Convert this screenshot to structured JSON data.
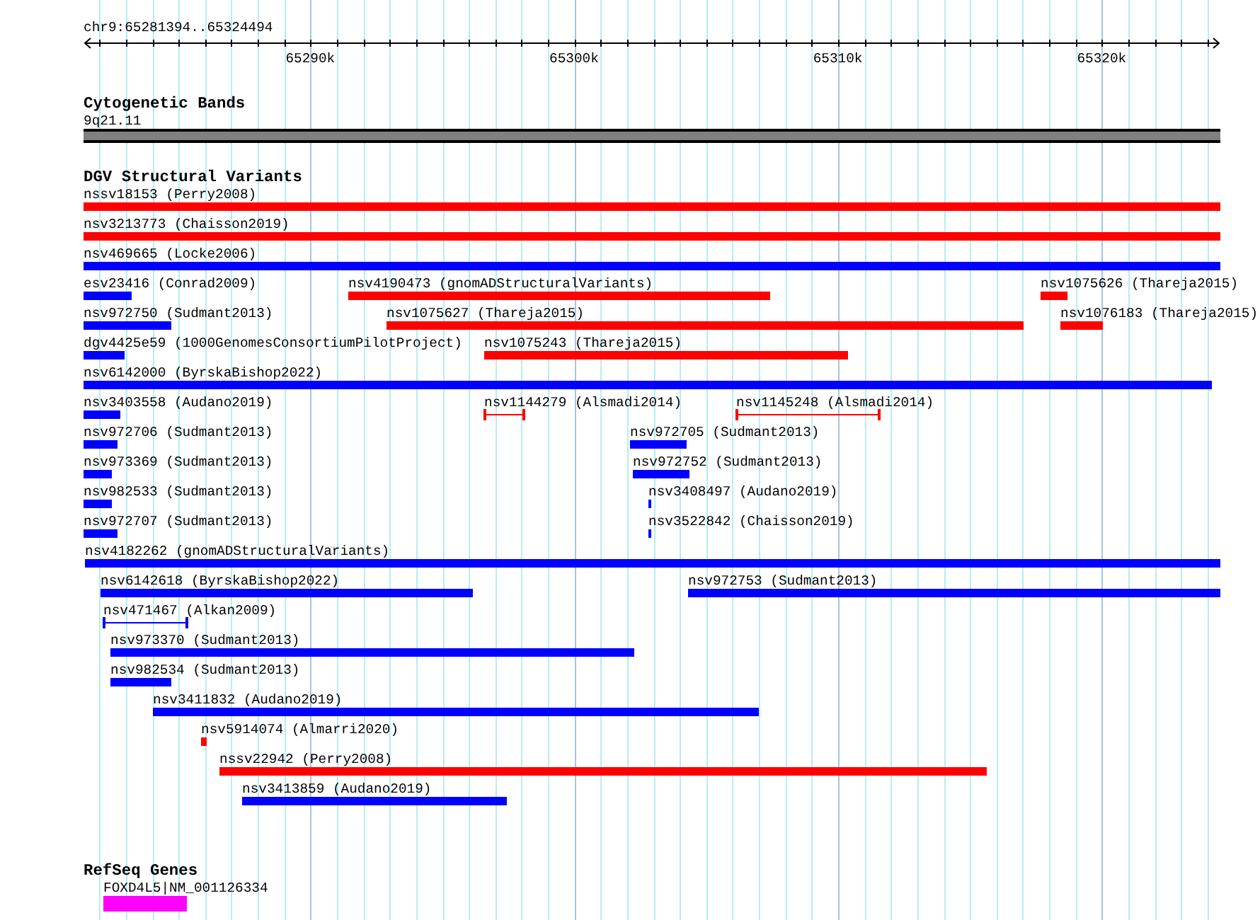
{
  "location": {
    "label": "chr9:65281394..65324494"
  },
  "ruler": {
    "ticks": [
      {
        "label": "65290k"
      },
      {
        "label": "65300k"
      },
      {
        "label": "65310k"
      },
      {
        "label": "65320k"
      }
    ]
  },
  "tracks": [
    {
      "kind": "cytoband",
      "title": "Cytogenetic Bands",
      "features": [
        {
          "label": "9q21.11"
        }
      ]
    },
    {
      "kind": "variants",
      "title": "DGV Structural Variants",
      "lanes": [
        {
          "features": [
            {
              "label": "nssv18153 (Perry2008)",
              "kind": "bar",
              "color": "#ff0000"
            }
          ]
        },
        {
          "features": [
            {
              "label": "nsv3213773 (Chaisson2019)",
              "kind": "bar",
              "color": "#ff0000"
            }
          ]
        },
        {
          "features": [
            {
              "label": "nsv469665 (Locke2006)",
              "kind": "bar",
              "color": "#0000ff"
            }
          ]
        },
        {
          "features": [
            {
              "label": "esv23416 (Conrad2009)",
              "kind": "bar",
              "color": "#0000ff"
            },
            {
              "label": "nsv4190473 (gnomADStructuralVariants)",
              "kind": "bar",
              "color": "#ff0000"
            },
            {
              "label": "nsv1075626 (Thareja2015)",
              "kind": "bar",
              "color": "#ff0000"
            }
          ]
        },
        {
          "features": [
            {
              "label": "nsv972750 (Sudmant2013)",
              "kind": "bar",
              "color": "#0000ff"
            },
            {
              "label": "nsv1075627 (Thareja2015)",
              "kind": "bar",
              "color": "#ff0000"
            },
            {
              "label": "nsv1076183 (Thareja2015)",
              "kind": "bar",
              "color": "#ff0000"
            }
          ]
        },
        {
          "features": [
            {
              "label": "dgv4425e59 (1000GenomesConsortiumPilotProject)",
              "kind": "bar",
              "color": "#0000ff"
            },
            {
              "label": "nsv1075243 (Thareja2015)",
              "kind": "bar",
              "color": "#ff0000"
            }
          ]
        },
        {
          "features": [
            {
              "label": "nsv6142000 (ByrskaBishop2022)",
              "kind": "bar",
              "color": "#0000ff"
            }
          ]
        },
        {
          "features": [
            {
              "label": "nsv3403558 (Audano2019)",
              "kind": "bar",
              "color": "#0000ff"
            },
            {
              "label": "nsv1144279 (Alsmadi2014)",
              "kind": "span",
              "color": "#ff0000"
            },
            {
              "label": "nsv1145248 (Alsmadi2014)",
              "kind": "span",
              "color": "#ff0000"
            }
          ]
        },
        {
          "features": [
            {
              "label": "nsv972706 (Sudmant2013)",
              "kind": "bar",
              "color": "#0000ff"
            },
            {
              "label": "nsv972705 (Sudmant2013)",
              "kind": "bar",
              "color": "#0000ff"
            }
          ]
        },
        {
          "features": [
            {
              "label": "nsv973369 (Sudmant2013)",
              "kind": "bar",
              "color": "#0000ff"
            },
            {
              "label": "nsv972752 (Sudmant2013)",
              "kind": "bar",
              "color": "#0000ff"
            }
          ]
        },
        {
          "features": [
            {
              "label": "nsv982533 (Sudmant2013)",
              "kind": "bar",
              "color": "#0000ff"
            },
            {
              "label": "nsv3408497 (Audano2019)",
              "kind": "bar",
              "color": "#0000ff"
            }
          ]
        },
        {
          "features": [
            {
              "label": "nsv972707 (Sudmant2013)",
              "kind": "bar",
              "color": "#0000ff"
            },
            {
              "label": "nsv3522842 (Chaisson2019)",
              "kind": "bar",
              "color": "#0000ff"
            }
          ]
        },
        {
          "features": [
            {
              "label": "nsv4182262 (gnomADStructuralVariants)",
              "kind": "bar",
              "color": "#0000ff"
            }
          ]
        },
        {
          "features": [
            {
              "label": "nsv6142618 (ByrskaBishop2022)",
              "kind": "bar",
              "color": "#0000ff"
            },
            {
              "label": "nsv972753 (Sudmant2013)",
              "kind": "bar",
              "color": "#0000ff"
            }
          ]
        },
        {
          "features": [
            {
              "label": "nsv471467 (Alkan2009)",
              "kind": "span",
              "color": "#0000ff"
            }
          ]
        },
        {
          "features": [
            {
              "label": "nsv973370 (Sudmant2013)",
              "kind": "bar",
              "color": "#0000ff"
            }
          ]
        },
        {
          "features": [
            {
              "label": "nsv982534 (Sudmant2013)",
              "kind": "bar",
              "color": "#0000ff"
            }
          ]
        },
        {
          "features": [
            {
              "label": "nsv3411832 (Audano2019)",
              "kind": "bar",
              "color": "#0000ff"
            }
          ]
        },
        {
          "features": [
            {
              "label": "nsv5914074 (Almarri2020)",
              "kind": "bar",
              "color": "#ff0000"
            }
          ]
        },
        {
          "features": [
            {
              "label": "nssv22942 (Perry2008)",
              "kind": "bar",
              "color": "#ff0000"
            }
          ]
        },
        {
          "features": [
            {
              "label": "nsv3413859 (Audano2019)",
              "kind": "bar",
              "color": "#0000ff"
            }
          ]
        }
      ]
    },
    {
      "kind": "genes",
      "title": "RefSeq Genes",
      "features": [
        {
          "label": "FOXD4L5|NM_001126334"
        }
      ]
    }
  ]
}
